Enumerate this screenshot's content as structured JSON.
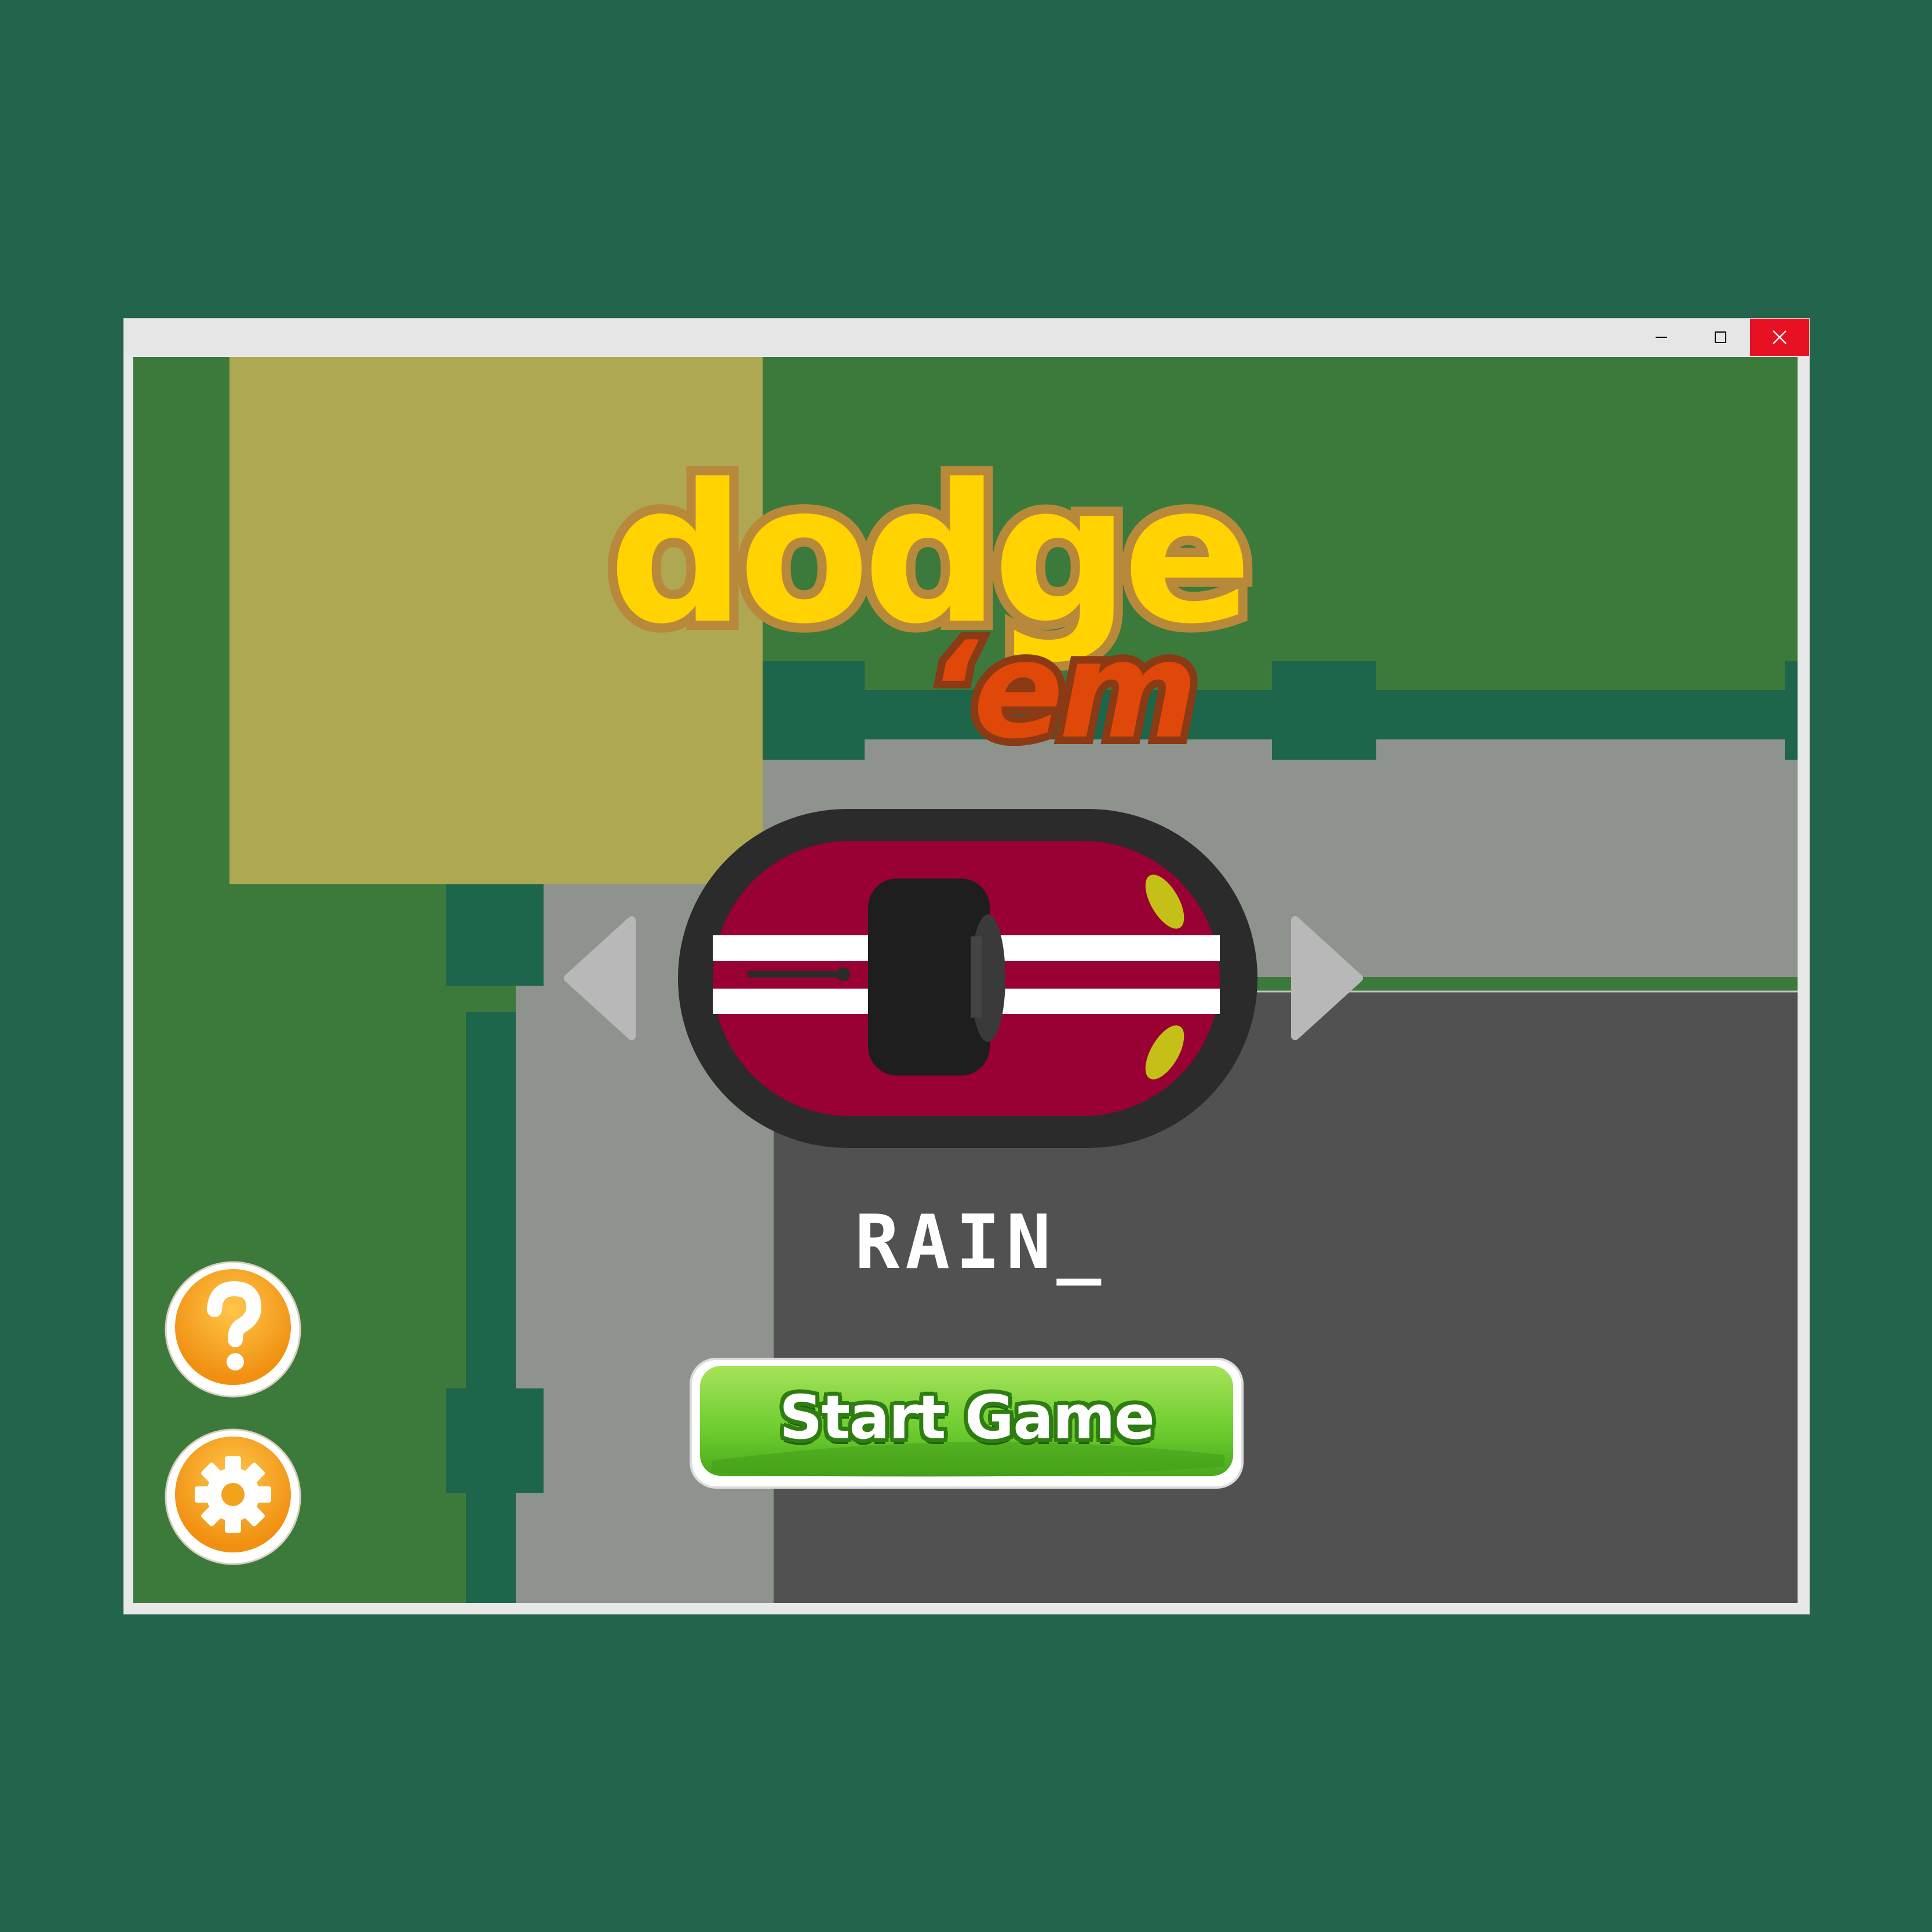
{
  "window": {
    "controls": {
      "minimize_icon": "minimize-icon",
      "maximize_icon": "maximize-icon",
      "close_icon": "close-icon",
      "close_color": "#e81123"
    }
  },
  "game": {
    "title_top": "dodge",
    "title_bottom": "‘em",
    "selected_car_name": "RAIN_",
    "start_button_label": "Start Game",
    "car_color": "#990033",
    "colors": {
      "grass": "#3c7a3c",
      "dark_green": "#1d654b",
      "sand": "#afa853",
      "light_road": "#8e938e",
      "dark_road": "#515151",
      "logo_yellow": "#ffd200",
      "logo_orange": "#e0480a",
      "button_green": "#6ccc2e",
      "button_orange": "#f5a520"
    },
    "icons": {
      "help": "question-mark-icon",
      "settings": "gear-icon",
      "prev": "arrow-left-icon",
      "next": "arrow-right-icon"
    }
  }
}
